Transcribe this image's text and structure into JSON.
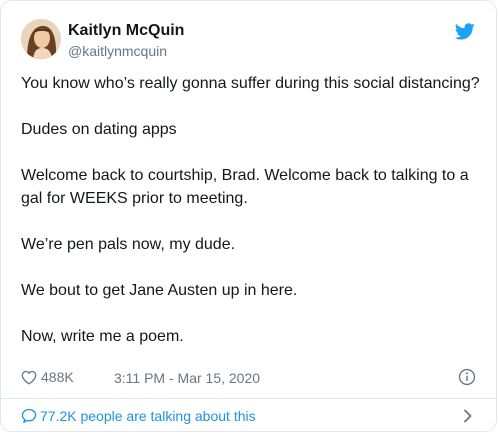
{
  "author": {
    "display_name": "Kaitlyn McQuin",
    "handle": "@kaitlynmcquin",
    "avatar_icon": "profile-photo"
  },
  "tweet": {
    "paragraphs": [
      "You know who’s really gonna suffer during this social distancing?",
      "Dudes on dating apps",
      "Welcome back to courtship, Brad. Welcome back to talking to a gal for WEEKS prior to meeting.",
      "We’re pen pals now, my dude.",
      "We bout to get Jane Austen up in here.",
      "Now, write me a poem."
    ]
  },
  "meta": {
    "like_count": "488K",
    "timestamp": "3:11 PM - Mar 15, 2020",
    "like_icon": "heart-outline-icon",
    "info_icon": "info-icon"
  },
  "footer": {
    "talking_label": "77.2K people are talking about this",
    "bubble_icon": "chat-bubble-icon",
    "chevron_icon": "chevron-right-icon"
  },
  "colors": {
    "twitter_blue": "#1da1f2",
    "link_blue": "#1b95e0",
    "text": "#14171a",
    "muted": "#657786",
    "border": "#e1e8ed"
  }
}
